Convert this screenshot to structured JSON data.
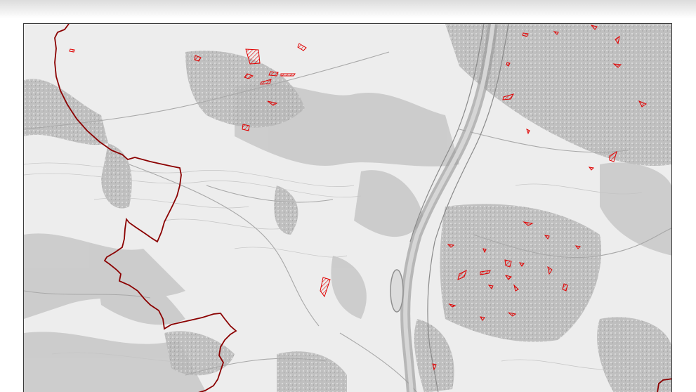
{
  "map": {
    "style": "grayscale topographic base map",
    "colors": {
      "background": "#ededed",
      "built_up": "#b9b9b9",
      "forest": "#c8c8c8",
      "river": "#9a9a9a",
      "boundary": "#8b0000",
      "highlight": "#e00000"
    }
  }
}
